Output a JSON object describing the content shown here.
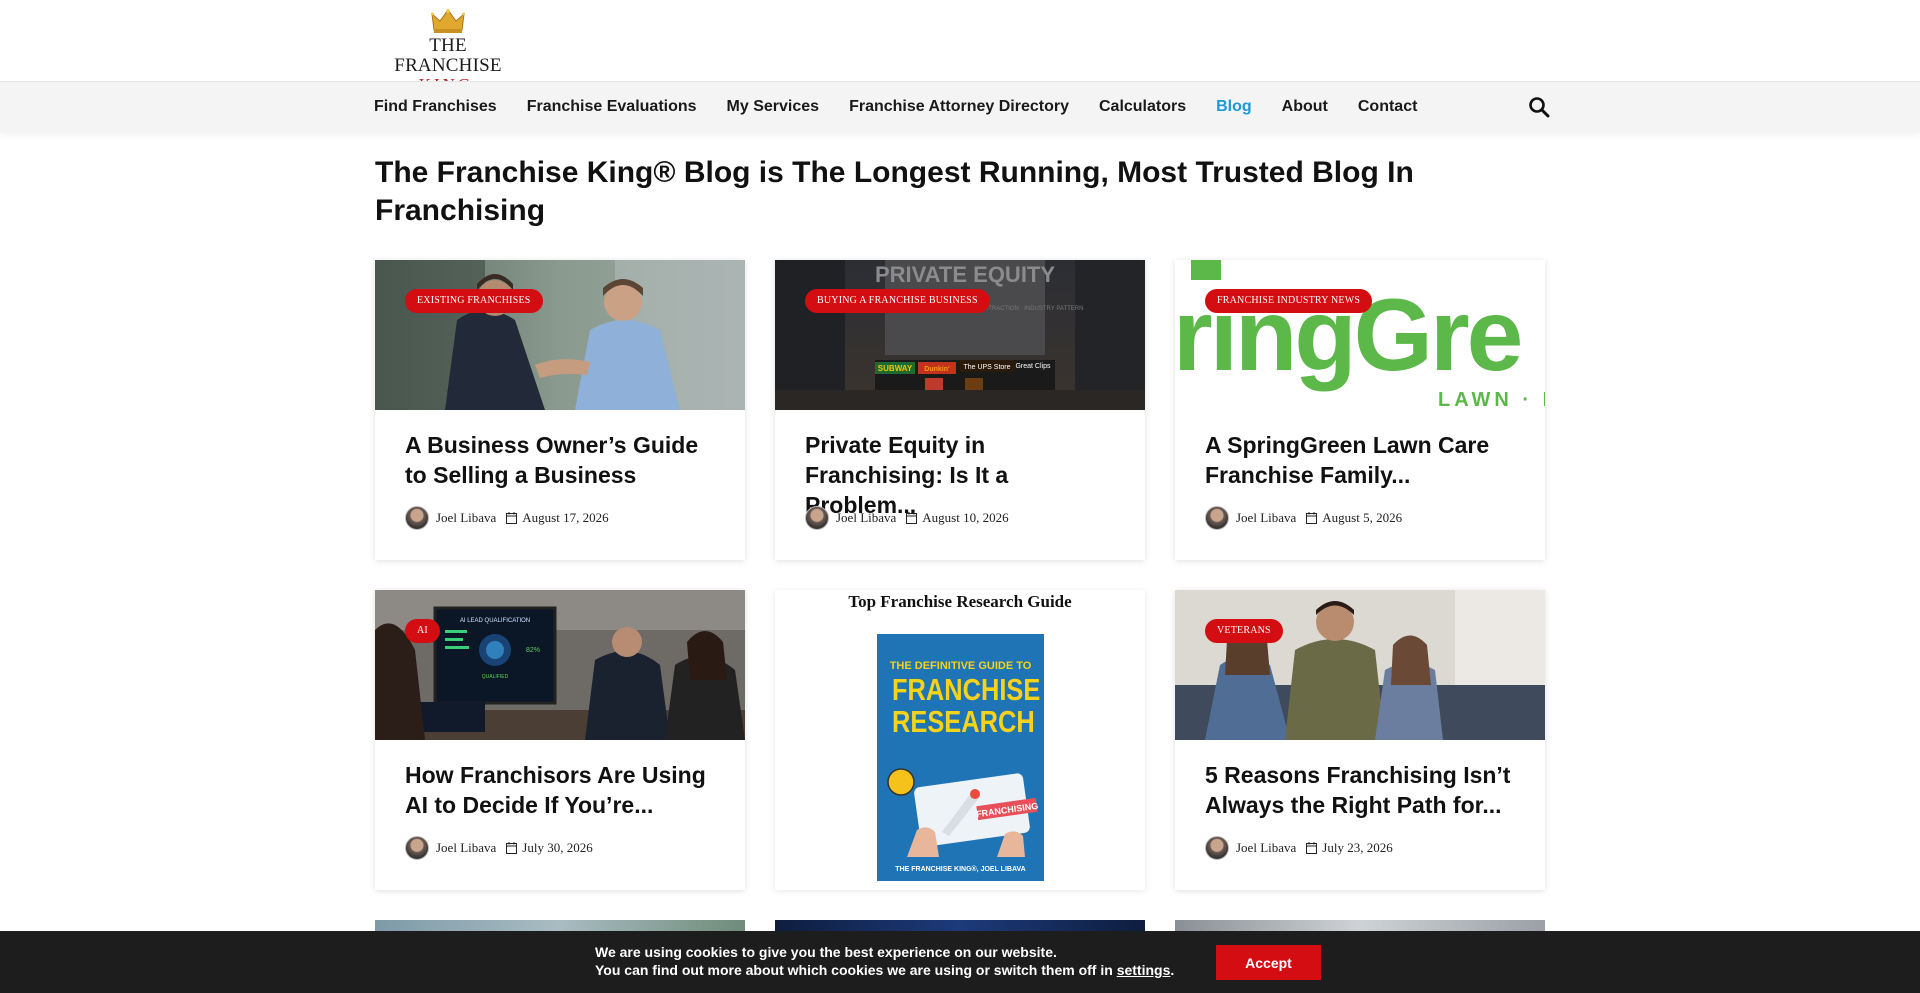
{
  "logo": {
    "line1": "THE FRANCHISE",
    "line2": "KING"
  },
  "nav": {
    "items": [
      {
        "label": "Find Franchises",
        "active": false
      },
      {
        "label": "Franchise Evaluations",
        "active": false
      },
      {
        "label": "My Services",
        "active": false
      },
      {
        "label": "Franchise Attorney Directory",
        "active": false
      },
      {
        "label": "Calculators",
        "active": false
      },
      {
        "label": "Blog",
        "active": true
      },
      {
        "label": "About",
        "active": false
      },
      {
        "label": "Contact",
        "active": false
      }
    ],
    "search_icon": "search-icon"
  },
  "page": {
    "title": "The Franchise King® Blog is The Longest Running, Most Trusted Blog In Franchising"
  },
  "posts": [
    {
      "category": "EXISTING FRANCHISES",
      "title": "A Business Owner’s Guide to Selling a Business",
      "author": "Joel Libava",
      "date": "August 17, 2026"
    },
    {
      "category": "BUYING A FRANCHISE BUSINESS",
      "title": "Private Equity in Franchising: Is It a Problem...",
      "author": "Joel Libava",
      "date": "August 10, 2026"
    },
    {
      "category": "FRANCHISE INDUSTRY NEWS",
      "title": "A SpringGreen Lawn Care Franchise Family...",
      "author": "Joel Libava",
      "date": "August 5, 2026"
    },
    {
      "category": "AI",
      "title": "How Franchisors Are Using AI to Decide If You’re...",
      "author": "Joel Libava",
      "date": "July 30, 2026"
    },
    {
      "category": "VETERANS",
      "title": "5 Reasons Franchising Isn’t Always the Right Path for...",
      "author": "Joel Libava",
      "date": "July 23, 2026"
    }
  ],
  "images": {
    "p2_sign": "PRIVATE EQUITY",
    "p2_sub": "CONSOLIDATION · DEBT · REVENUE · PROFIT EXTRACTION · INDUSTRY PATTERN",
    "p2_shops": [
      "SUBWAY",
      "Dunkin'",
      "The UPS Store",
      "Great Clips"
    ],
    "p3_logo": "ringGre",
    "p3_sub": "LAWN · P",
    "p4_screen_title": "AI LEAD QUALIFICATION",
    "p4_percent": "82%",
    "p4_status": "QUALIFIED"
  },
  "guide": {
    "title": "Top Franchise Research Guide",
    "book_line1": "THE DEFINITIVE GUIDE TO",
    "book_line2a": "FRANCHISE",
    "book_line2b": "RESEARCH",
    "book_card": "FRANCHISING",
    "book_author": "THE FRANCHISE KING®, JOEL LIBAVA"
  },
  "cookie": {
    "line1": "We are using cookies to give you the best experience on our website.",
    "line2_prefix": "You can find out more about which cookies we are using or switch them off in",
    "settings_link": "settings",
    "line2_suffix": ".",
    "accept_label": "Accept"
  },
  "colors": {
    "accent": "#d40d12",
    "nav_active": "#1e98d7",
    "springgreen_green": "#5cb848",
    "springgreen_blue": "#2a7ab0"
  }
}
